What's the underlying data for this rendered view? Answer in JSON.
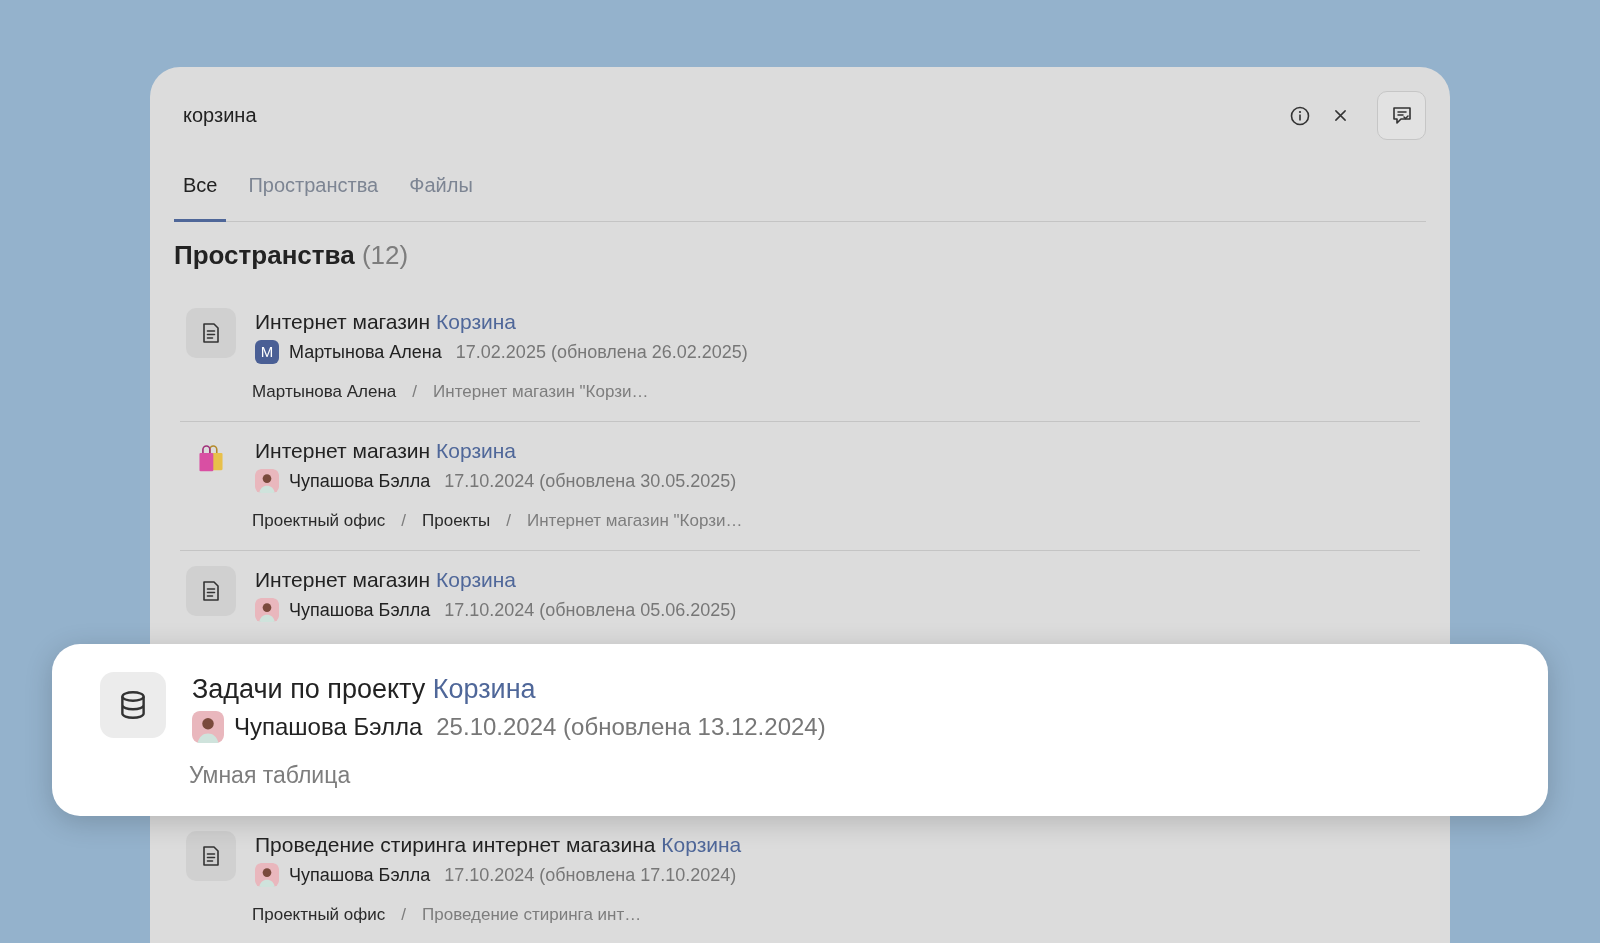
{
  "search": {
    "value": "корзина"
  },
  "tabs": [
    {
      "label": "Все",
      "selected": true
    },
    {
      "label": "Пространства",
      "selected": false
    },
    {
      "label": "Файлы",
      "selected": false
    }
  ],
  "section": {
    "title": "Пространства",
    "count": "(12)"
  },
  "results": [
    {
      "kind": "page",
      "title": "Интернет магазин",
      "match": "Корзина",
      "avatar": {
        "kind": "letter",
        "letter": "М"
      },
      "author": "Мартынова Алена",
      "date": "17.02.2025 (обновлена 26.02.2025)",
      "highlighted": false,
      "path": [
        {
          "kind": "crumb",
          "text": "Мартынова Алена"
        },
        {
          "kind": "separator",
          "text": "/"
        },
        {
          "kind": "current",
          "text": "Интернет магазин \"Корзи…"
        }
      ]
    },
    {
      "kind": "bag",
      "title": "Интернет магазин",
      "match": "Корзина",
      "avatar": {
        "kind": "photo"
      },
      "author": "Чупашова Бэлла",
      "date": "17.10.2024 (обновлена 30.05.2025)",
      "highlighted": false,
      "path": [
        {
          "kind": "crumb",
          "text": "Проектный офис"
        },
        {
          "kind": "separator",
          "text": "/"
        },
        {
          "kind": "crumb",
          "text": "Проекты"
        },
        {
          "kind": "separator",
          "text": "/"
        },
        {
          "kind": "current",
          "text": "Интернет магазин \"Корзи…"
        }
      ]
    },
    {
      "kind": "page",
      "title": "Интернет магазин",
      "match": "Корзина",
      "avatar": {
        "kind": "photo"
      },
      "author": "Чупашова Бэлла",
      "date": "17.10.2024 (обновлена 05.06.2025)",
      "highlighted": false
    },
    {
      "kind": "table",
      "title": "Задачи по проекту",
      "match": "Корзина",
      "avatar": {
        "kind": "photo"
      },
      "author": "Чупашова Бэлла",
      "date": "25.10.2024 (обновлена 13.12.2024)",
      "highlighted": true,
      "path": [
        {
          "kind": "current",
          "text": "Умная таблица"
        }
      ]
    },
    {
      "kind": "page",
      "title": "Проведение стиринга интернет магазина",
      "match": "Корзина",
      "avatar": {
        "kind": "photo"
      },
      "author": "Чупашова Бэлла",
      "date": "17.10.2024 (обновлена 17.10.2024)",
      "highlighted": false,
      "path": [
        {
          "kind": "crumb",
          "text": "Проектный офис"
        },
        {
          "kind": "separator",
          "text": "/"
        },
        {
          "kind": "current",
          "text": "Проведение стиринга инт…"
        }
      ]
    }
  ]
}
